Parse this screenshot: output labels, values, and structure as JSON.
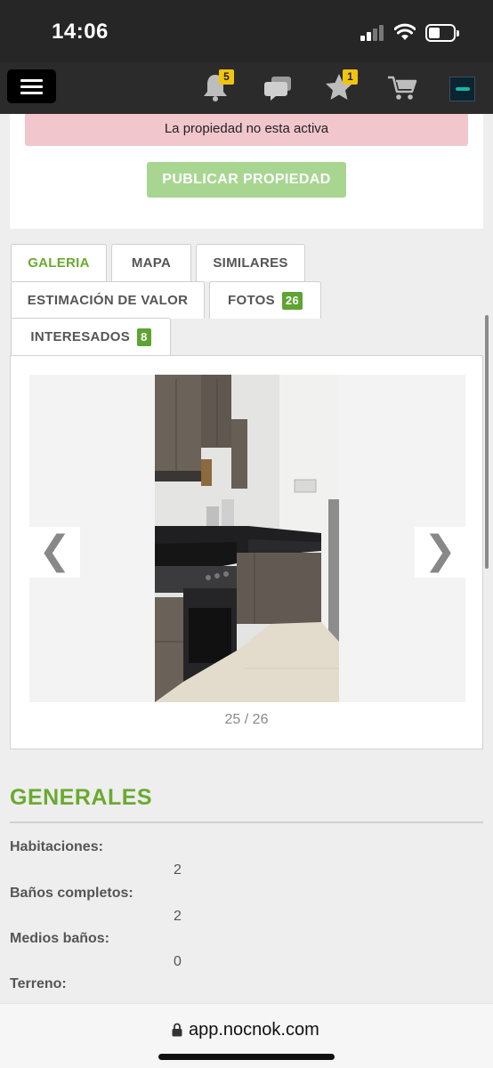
{
  "status_bar": {
    "time": "14:06"
  },
  "nav": {
    "notifications_count": "5",
    "favorites_count": "1",
    "colors": {
      "badge": "#f1c40f",
      "background": "#2b2b2b"
    }
  },
  "alert": {
    "text": "La propiedad no esta activa"
  },
  "publish_button": {
    "label": "PUBLICAR PROPIEDAD"
  },
  "tabs": [
    {
      "label": "GALERIA",
      "active": true
    },
    {
      "label": "MAPA"
    },
    {
      "label": "SIMILARES"
    },
    {
      "label": "ESTIMACIÓN DE VALOR"
    },
    {
      "label": "FOTOS",
      "count": "26"
    },
    {
      "label": "INTERESADOS",
      "count": "8"
    }
  ],
  "gallery": {
    "prev_glyph": "❮",
    "next_glyph": "❯",
    "counter": "25 / 26"
  },
  "generales": {
    "title": "GENERALES",
    "items": [
      {
        "label": "Habitaciones:",
        "value": "2"
      },
      {
        "label": "Baños completos:",
        "value": "2"
      },
      {
        "label": "Medios baños:",
        "value": "0"
      },
      {
        "label": "Terreno:",
        "value": ""
      }
    ]
  },
  "browser": {
    "url": "app.nocnok.com"
  },
  "colors": {
    "accent": "#6aaa2f",
    "badge_green": "#5fa333",
    "alert_bg": "#f2c6cd"
  }
}
